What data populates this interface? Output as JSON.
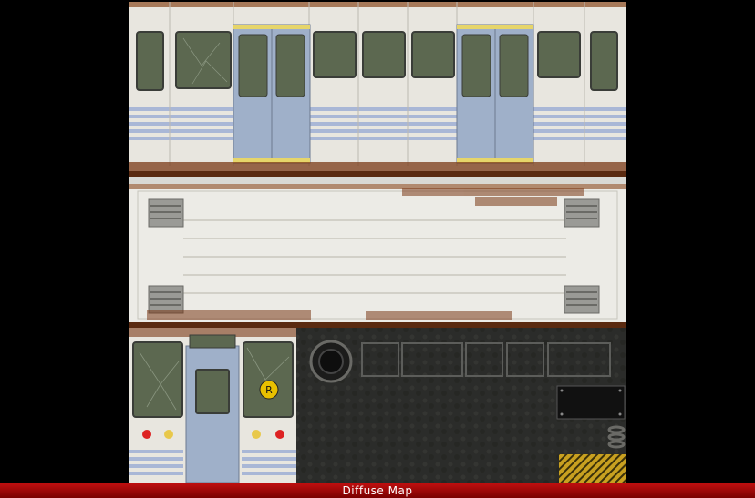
{
  "caption": "Diffuse Map",
  "texture": {
    "route_badge": "R",
    "colors": {
      "paint": "#e8e6df",
      "stripe": "#a9b7d6",
      "door": "#9fb0c9",
      "rust": "#7b3a17",
      "glass": "#5c6850",
      "metal": "#2c2d2b",
      "caption_bar": "#b00f0f",
      "background": "#000000"
    }
  }
}
